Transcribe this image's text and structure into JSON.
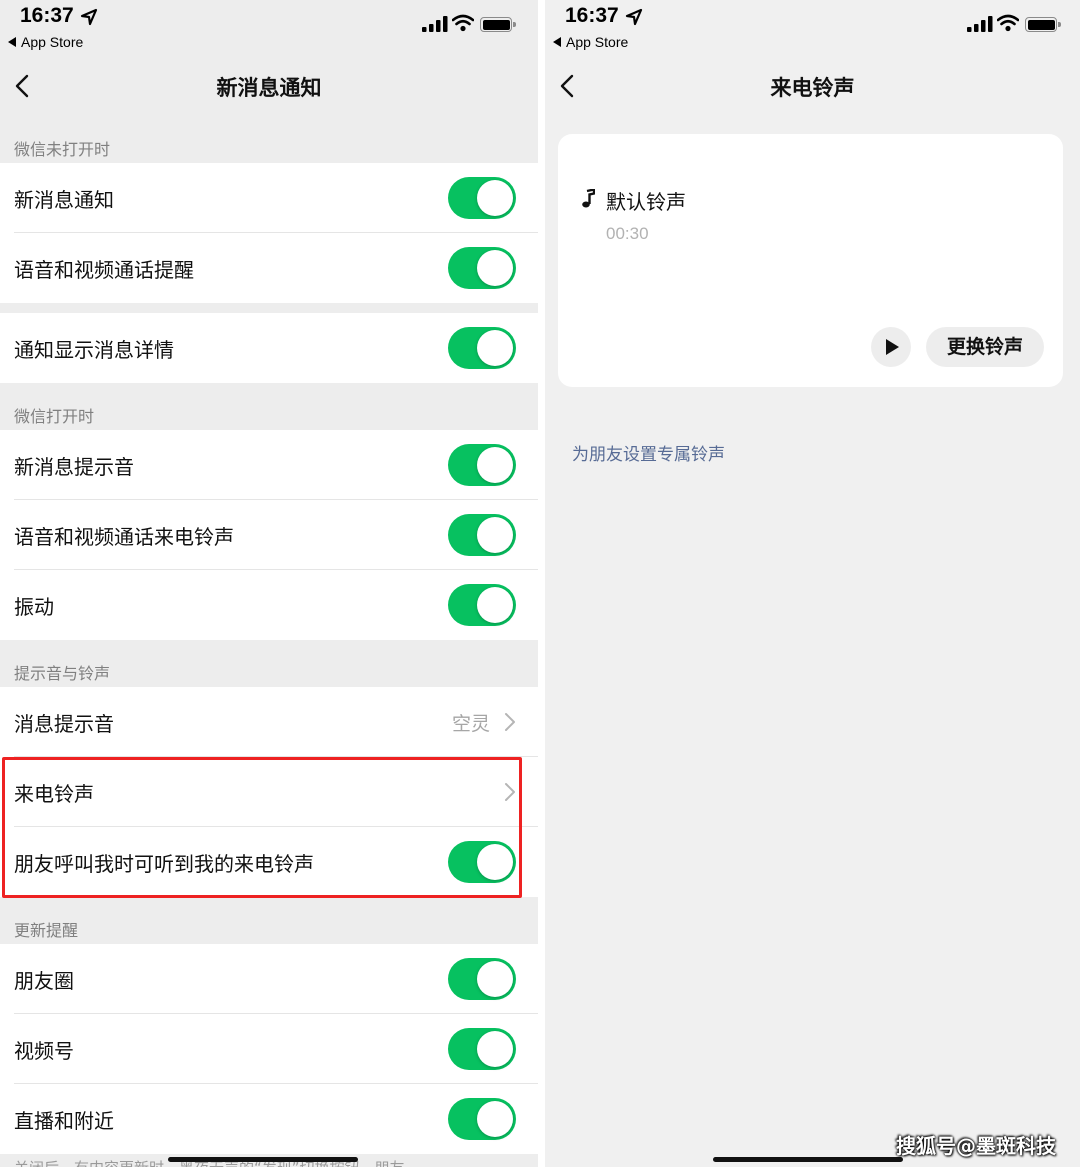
{
  "status_bar": {
    "time": "16:37",
    "back_app": "App Store"
  },
  "left": {
    "title": "新消息通知",
    "sections": [
      {
        "header": "微信未打开时",
        "rows": [
          {
            "label": "新消息通知",
            "type": "toggle",
            "on": true
          },
          {
            "label": "语音和视频通话提醒",
            "type": "toggle",
            "on": true
          }
        ]
      },
      {
        "header": "",
        "rows": [
          {
            "label": "通知显示消息详情",
            "type": "toggle",
            "on": true
          }
        ]
      },
      {
        "header": "微信打开时",
        "rows": [
          {
            "label": "新消息提示音",
            "type": "toggle",
            "on": true
          },
          {
            "label": "语音和视频通话来电铃声",
            "type": "toggle",
            "on": true
          },
          {
            "label": "振动",
            "type": "toggle",
            "on": true
          }
        ]
      },
      {
        "header": "提示音与铃声",
        "rows": [
          {
            "label": "消息提示音",
            "type": "link",
            "value": "空灵"
          },
          {
            "label": "来电铃声",
            "type": "link",
            "value": ""
          },
          {
            "label": "朋友呼叫我时可听到我的来电铃声",
            "type": "toggle",
            "on": true
          }
        ]
      },
      {
        "header": "更新提醒",
        "rows": [
          {
            "label": "朋友圈",
            "type": "toggle",
            "on": true
          },
          {
            "label": "视频号",
            "type": "toggle",
            "on": true
          },
          {
            "label": "直播和附近",
            "type": "toggle",
            "on": true
          }
        ]
      }
    ],
    "footnote": "关闭后，有内容更新时，黑夜无声的“发现”切换按钮，朋友"
  },
  "right": {
    "title": "来电铃声",
    "ringtone_name": "默认铃声",
    "ringtone_duration": "00:30",
    "change_button": "更换铃声",
    "friend_link": "为朋友设置专属铃声"
  },
  "watermark": "搜狐号@墨斑科技",
  "colors": {
    "toggle_on": "#07c160",
    "link": "#576b95",
    "highlight": "#ee2222"
  },
  "icons": [
    "back-chevron-icon",
    "location-arrow-icon",
    "signal-icon",
    "wifi-icon",
    "battery-icon",
    "chevron-right-icon",
    "music-note-icon",
    "play-icon"
  ]
}
